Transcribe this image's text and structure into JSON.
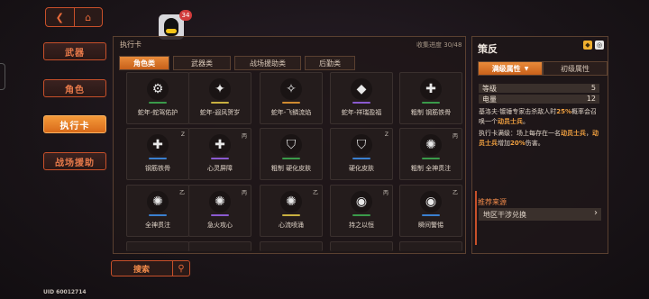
{
  "header": {
    "back_icon": "back-icon",
    "home_icon": "home-icon",
    "avatar_badge": "34"
  },
  "nav": [
    {
      "label": "武器",
      "active": false
    },
    {
      "label": "角色",
      "active": false
    },
    {
      "label": "执行卡",
      "active": true
    },
    {
      "label": "战场援助",
      "active": false
    }
  ],
  "panel": {
    "title": "执行卡",
    "collect_label": "收集进度",
    "collect_value": "30/48",
    "tabs": [
      {
        "label": "角色类",
        "active": true
      },
      {
        "label": "武器类",
        "active": false
      },
      {
        "label": "战场援助类",
        "active": false
      },
      {
        "label": "后勤类",
        "active": false
      }
    ],
    "cards": [
      {
        "label": "蛇年-蛇驾佑护",
        "corner": "",
        "bar_color": "#3a9a4a",
        "glyph": "⚙"
      },
      {
        "label": "蛇年-遐风贺岁",
        "corner": "",
        "bar_color": "#c8b040",
        "glyph": "✦"
      },
      {
        "label": "蛇年-飞鳞流焰",
        "corner": "",
        "bar_color": "#d08a30",
        "glyph": "✧"
      },
      {
        "label": "蛇年-祥瑞盈福",
        "corner": "",
        "bar_color": "#8a5ad0",
        "glyph": "◆"
      },
      {
        "label": "粗制 钢筋铁骨",
        "corner": "",
        "bar_color": "#3a9a4a",
        "glyph": "✚"
      },
      {
        "label": "钢筋铁骨",
        "corner": "Z",
        "bar_color": "#3a80d0",
        "glyph": "✚"
      },
      {
        "label": "心灵屏障",
        "corner": "丙",
        "bar_color": "#8a5ad0",
        "glyph": "✚"
      },
      {
        "label": "粗制 硬化皮肤",
        "corner": "",
        "bar_color": "#3a9a4a",
        "glyph": "⛉"
      },
      {
        "label": "硬化皮肤",
        "corner": "Z",
        "bar_color": "#3a80d0",
        "glyph": "⛉"
      },
      {
        "label": "粗制 全神贯注",
        "corner": "丙",
        "bar_color": "#3a9a4a",
        "glyph": "✺"
      },
      {
        "label": "全神贯注",
        "corner": "乙",
        "bar_color": "#3a80d0",
        "glyph": "✺"
      },
      {
        "label": "急火攻心",
        "corner": "丙",
        "bar_color": "#8a5ad0",
        "glyph": "✺"
      },
      {
        "label": "心流喷涌",
        "corner": "乙",
        "bar_color": "#c8b040",
        "glyph": "✺"
      },
      {
        "label": "持之以恒",
        "corner": "丙",
        "bar_color": "#3a9a4a",
        "glyph": "◉"
      },
      {
        "label": "瞬间警惕",
        "corner": "乙",
        "bar_color": "#3a80d0",
        "glyph": "◉"
      }
    ]
  },
  "search": {
    "label": "搜索"
  },
  "uid": "UID 60012714",
  "detail": {
    "title": "策反",
    "tabs": [
      {
        "label": "满级属性",
        "active": true
      },
      {
        "label": "初级属性",
        "active": false
      }
    ],
    "stats": [
      {
        "key": "等级",
        "value": "5"
      },
      {
        "key": "电量",
        "value": "12"
      }
    ],
    "desc1_pre": "基洛夫·镀锤专家击杀敌人时",
    "desc1_hl1": "25%",
    "desc1_mid": "概率会召唤一个",
    "desc1_hl2": "动员士兵",
    "desc1_post": "。",
    "desc2_pre": "执行卡满级：场上每存在一名",
    "desc2_hl1": "动员士兵",
    "desc2_mid": "，",
    "desc2_hl2": "动员士兵",
    "desc2_mid2": "增加",
    "desc2_hl3": "20%",
    "desc2_post": "伤害。",
    "source_title": "推荐来源",
    "source_item": "地区干涉兑换"
  },
  "colors": {
    "accent": "#e86a3a",
    "active": "#e88a3a",
    "panel": "#241c1c"
  }
}
